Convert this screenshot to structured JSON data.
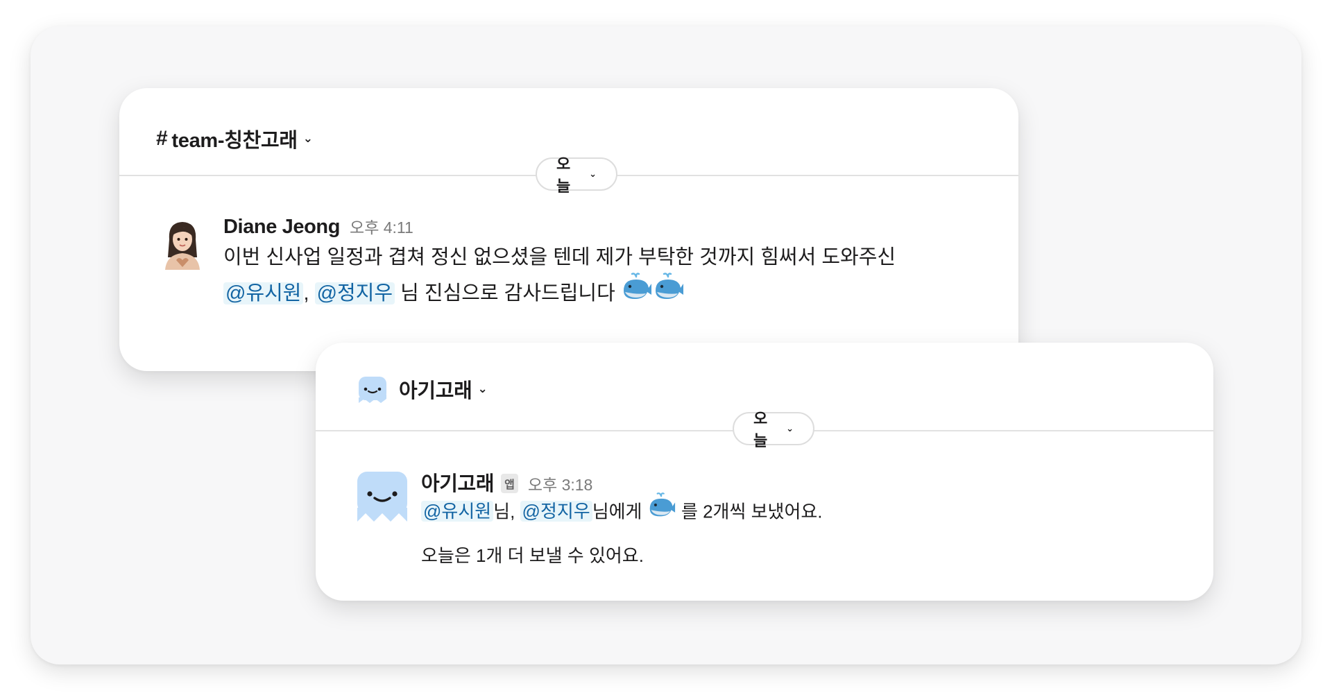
{
  "team_card": {
    "channel_hash": "#",
    "channel_name": "team-칭찬고래",
    "date_label": "오늘",
    "message": {
      "sender": "Diane Jeong",
      "time": "오후 4:11",
      "line1": "이번 신사업 일정과 겹쳐 정신 없으셨을 텐데 제가 부탁한 것까지 힘써서 도와주신",
      "mention1": "@유시원",
      "comma": ",",
      "mention2": "@정지우",
      "line2_rest": "님 진심으로 감사드립니다",
      "emoji": "whale-icon x2"
    }
  },
  "bot_card": {
    "channel_name": "아기고래",
    "date_label": "오늘",
    "message": {
      "sender": "아기고래",
      "badge": "앱",
      "time": "오후 3:18",
      "mention1": "@유시원",
      "after_mention1": "님,",
      "mention2": "@정지우",
      "after_mention2": "님에게",
      "after_emoji": "를 2개씩 보냈어요.",
      "line2": "오늘은 1개 더 보낼 수 있어요."
    }
  },
  "colors": {
    "mention_text": "#1264a3",
    "mention_bg": "#e8f5fa",
    "time_text": "#7a7a7a",
    "bot_avatar": "#bfdcf9"
  }
}
